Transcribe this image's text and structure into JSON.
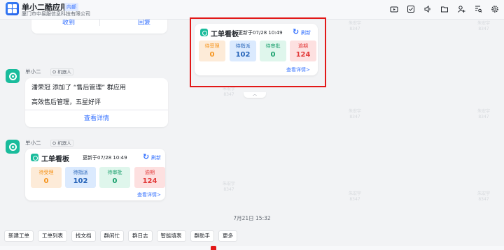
{
  "header": {
    "app_name": "单小二酷应用",
    "tag": "内部",
    "org": "厦门市中易服信息科技有限公司",
    "icons": [
      "video-icon",
      "checkbox-icon",
      "speaker-icon",
      "folder-icon",
      "add-member-icon",
      "search-doc-icon",
      "settings-icon"
    ]
  },
  "top_bubble": {
    "left_action": "收到",
    "right_action": "回复"
  },
  "message": {
    "sender": "单小二",
    "badge": "机器人",
    "line1": "潘荣冠 添加了 “售后管理” 群应用",
    "line2": "高效售后管理，五星好评",
    "link": "查看详情"
  },
  "board_message": {
    "sender": "单小二",
    "badge": "机器人"
  },
  "board": {
    "title": "工单看板",
    "updated": "更新于07/28 10:49",
    "refresh": "刷新",
    "tiles": [
      {
        "label": "待受理",
        "value": "0"
      },
      {
        "label": "待指派",
        "value": "102"
      },
      {
        "label": "待审批",
        "value": "0"
      },
      {
        "label": "逾期",
        "value": "124"
      }
    ],
    "more": "查看详情>"
  },
  "timestamp": "7月21日 15:32",
  "watermark": [
    "朱宏宇",
    "8347"
  ],
  "shortcuts": [
    "新建工单",
    "工单列表",
    "找文档",
    "群闲忙",
    "群日志",
    "智能填表",
    "群助手",
    "更多"
  ],
  "colors": {
    "highlight": "#e21818",
    "accent": "#3370ff",
    "avatar": "#1abc9c"
  }
}
